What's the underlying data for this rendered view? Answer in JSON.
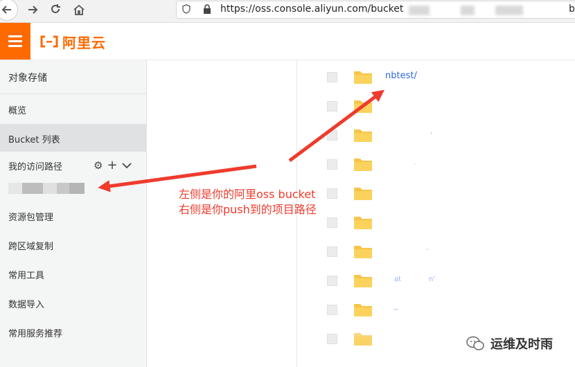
{
  "browser": {
    "url": "https://oss.console.aliyun.com/bucket",
    "url_tail": "b"
  },
  "header": {
    "logo_text": "阿里云",
    "brand_color": "#ff6a00"
  },
  "sidebar": {
    "title": "对象存储",
    "items": [
      {
        "label": "概览"
      },
      {
        "label": "Bucket 列表",
        "active": true
      },
      {
        "label": "我的访问路径"
      },
      {
        "label": "资源包管理"
      },
      {
        "label": "跨区域复制"
      },
      {
        "label": "常用工具"
      },
      {
        "label": "数据导入"
      },
      {
        "label": "常用服务推荐"
      }
    ]
  },
  "files": [
    {
      "name": "nbtest/"
    },
    {
      "name": ""
    },
    {
      "name": ""
    },
    {
      "name": ""
    },
    {
      "name": ""
    },
    {
      "name": ""
    },
    {
      "name": ""
    },
    {
      "name": ""
    },
    {
      "name": ""
    },
    {
      "name": ""
    }
  ],
  "annotation": {
    "line1": "左侧是你的阿里oss bucket",
    "line2": "右侧是你push到的项目路径",
    "color": "#ef3b2d"
  },
  "watermark": {
    "text": "运维及时雨"
  }
}
